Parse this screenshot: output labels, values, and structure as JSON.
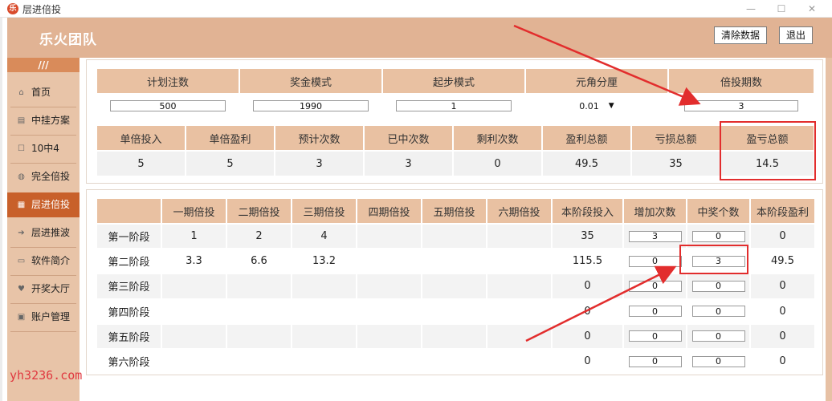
{
  "window": {
    "title": "层进倍投",
    "app_icon_text": "乐"
  },
  "header": {
    "team": "乐火团队",
    "clear_label": "清除数据",
    "exit_label": "退出"
  },
  "sidebar": {
    "top": "///",
    "items": [
      {
        "icon": "⌂",
        "label": "首页"
      },
      {
        "icon": "▤",
        "label": "中挂方案"
      },
      {
        "icon": "☐",
        "label": "10中4"
      },
      {
        "icon": "◍",
        "label": "完全倍投"
      },
      {
        "icon": "▦",
        "label": "层进倍投"
      },
      {
        "icon": "➔",
        "label": "层进推波"
      },
      {
        "icon": "▭",
        "label": "软件简介"
      },
      {
        "icon": "♥",
        "label": "开奖大厅"
      },
      {
        "icon": "▣",
        "label": "账户管理"
      }
    ]
  },
  "settings": {
    "headers": [
      "计划注数",
      "奖金模式",
      "起步模式",
      "元角分厘",
      "倍投期数"
    ],
    "plan_count": "500",
    "bonus_mode": "1990",
    "start_mode": "1",
    "unit": "0.01",
    "periods": "3"
  },
  "stats": {
    "headers": [
      "单倍投入",
      "单倍盈利",
      "预计次数",
      "已中次数",
      "剩利次数",
      "盈利总额",
      "亏损总额",
      "盈亏总额"
    ],
    "values": [
      "5",
      "5",
      "3",
      "3",
      "0",
      "49.5",
      "35",
      "14.5"
    ]
  },
  "stages": {
    "headers": [
      "",
      "一期倍投",
      "二期倍投",
      "三期倍投",
      "四期倍投",
      "五期倍投",
      "六期倍投",
      "本阶段投入",
      "增加次数",
      "中奖个数",
      "本阶段盈利"
    ],
    "rows": [
      {
        "label": "第一阶段",
        "m": [
          "1",
          "2",
          "4",
          "",
          "",
          ""
        ],
        "invest": "35",
        "add": "3",
        "win": "0",
        "profit": "0"
      },
      {
        "label": "第二阶段",
        "m": [
          "3.3",
          "6.6",
          "13.2",
          "",
          "",
          ""
        ],
        "invest": "115.5",
        "add": "0",
        "win": "3",
        "profit": "49.5"
      },
      {
        "label": "第三阶段",
        "m": [
          "",
          "",
          "",
          "",
          "",
          ""
        ],
        "invest": "0",
        "add": "0",
        "win": "0",
        "profit": "0"
      },
      {
        "label": "第四阶段",
        "m": [
          "",
          "",
          "",
          "",
          "",
          ""
        ],
        "invest": "0",
        "add": "0",
        "win": "0",
        "profit": "0"
      },
      {
        "label": "第五阶段",
        "m": [
          "",
          "",
          "",
          "",
          "",
          ""
        ],
        "invest": "0",
        "add": "0",
        "win": "0",
        "profit": "0"
      },
      {
        "label": "第六阶段",
        "m": [
          "",
          "",
          "",
          "",
          "",
          ""
        ],
        "invest": "0",
        "add": "0",
        "win": "0",
        "profit": "0"
      }
    ]
  },
  "watermark": "yh3236.com",
  "colors": {
    "header": "#e1b394",
    "accent": "#c8602a",
    "table_header": "#e9c1a2",
    "annotation": "#e22d2d"
  }
}
